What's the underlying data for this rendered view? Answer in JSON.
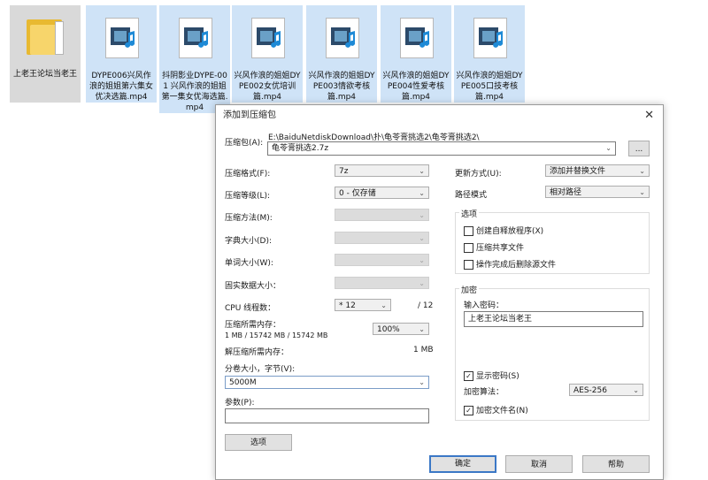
{
  "files": [
    {
      "caption": "上老王论坛当老王",
      "type": "folder",
      "icon": "folder-icon"
    },
    {
      "caption": "DYPE006兴风作浪的姐姐第六集女优决选篇.mp4",
      "type": "video",
      "icon": "video-file-icon"
    },
    {
      "caption": "抖阴影业DYPE-001 兴风作浪的姐姐第一集女优海选篇.mp4",
      "type": "video",
      "icon": "video-file-icon"
    },
    {
      "caption": "兴风作浪的姐姐DYPE002女优培训篇.mp4",
      "type": "video",
      "icon": "video-file-icon"
    },
    {
      "caption": "兴风作浪的姐姐DYPE003情欲考核篇.mp4",
      "type": "video",
      "icon": "video-file-icon"
    },
    {
      "caption": "兴风作浪的姐姐DYPE004性爱考核篇.mp4",
      "type": "video",
      "icon": "video-file-icon"
    },
    {
      "caption": "兴风作浪的姐姐DYPE005口技考核篇.mp4",
      "type": "video",
      "icon": "video-file-icon"
    }
  ],
  "dialog": {
    "title": "添加到压缩包",
    "close_glyph": "✕",
    "archive_label": "压缩包(A):",
    "archive_path": "E:\\BaiduNetdiskDownload\\扑\\龟苓膏挑选2\\龟苓膏挑选2\\",
    "archive_name": "龟苓膏挑选2.7z",
    "browse_label": "...",
    "format_label": "压缩格式(F):",
    "format_value": "7z",
    "level_label": "压缩等级(L):",
    "level_value": "0 - 仅存储",
    "method_label": "压缩方法(M):",
    "dict_label": "字典大小(D):",
    "word_label": "单词大小(W):",
    "solid_label": "固实数据大小：",
    "cpu_label": "CPU 线程数：",
    "cpu_value": "* 12",
    "cpu_total": "/ 12",
    "mem_comp_label": "压缩所需内存：",
    "mem_comp_value": "1 MB / 15742 MB / 15742 MB",
    "mem_percent": "100%",
    "mem_decomp_label": "解压缩所需内存：",
    "mem_decomp_value": "1 MB",
    "split_label": "分卷大小，字节(V):",
    "split_value": "5000M",
    "params_label": "参数(P):",
    "params_value": "",
    "options_button": "选项",
    "update_label": "更新方式(U):",
    "update_value": "添加并替换文件",
    "path_label": "路径模式",
    "path_value": "相对路径",
    "options_group": "选项",
    "opt_sfx": "创建自释放程序(X)",
    "opt_shared": "压缩共享文件",
    "opt_delete": "操作完成后删除源文件",
    "encrypt_group": "加密",
    "password_label": "输入密码：",
    "password_value": "上老王论坛当老王",
    "show_password": "显示密码(S)",
    "encrypt_method_label": "加密算法：",
    "encrypt_method_value": "AES-256",
    "encrypt_names": "加密文件名(N)",
    "ok_button": "确定",
    "cancel_button": "取消",
    "help_button": "帮助",
    "check_glyph": "✓",
    "arrow_glyph": "⌄"
  }
}
